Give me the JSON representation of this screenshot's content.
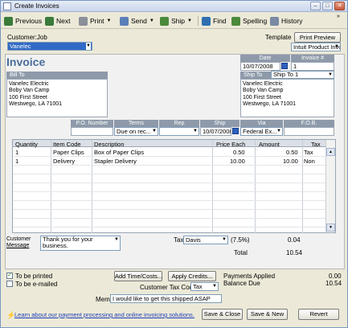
{
  "window": {
    "title": "Create Invoices"
  },
  "toolbar": {
    "previous": "Previous",
    "next": "Next",
    "print": "Print",
    "send": "Send",
    "ship": "Ship",
    "find": "Find",
    "spelling": "Spelling",
    "history": "History"
  },
  "header": {
    "customer_job_label": "Customer:Job",
    "customer_job_value": "Vanelec",
    "template_label": "Template",
    "print_preview": "Print Preview",
    "template_value": "Intuit Product Invoice"
  },
  "invoice": {
    "heading": "Invoice",
    "date_label": "Date",
    "date_value": "10/07/2008",
    "number_label": "Invoice #",
    "number_value": "1",
    "bill_to_label": "Bill To",
    "bill_to_lines": [
      "Vanelec Electric",
      "Boby Van Camp",
      "100 First Street",
      "Westwego, LA 71001"
    ],
    "ship_to_label": "Ship To",
    "ship_to_value": "Ship To 1",
    "ship_to_lines": [
      "Vanelec Electric",
      "Boby Van Camp",
      "100 First Street",
      "Westwego, LA 71001"
    ]
  },
  "details": {
    "po_label": "P.O. Number",
    "po_value": "",
    "terms_label": "Terms",
    "terms_value": "Due on rec...",
    "rep_label": "Rep",
    "rep_value": "",
    "ship_label": "Ship",
    "ship_value": "10/07/2008",
    "via_label": "Via",
    "via_value": "Federal Ex...",
    "fob_label": "F.O.B.",
    "fob_value": ""
  },
  "table": {
    "columns": [
      "Quantity",
      "Item Code",
      "Description",
      "Price Each",
      "Amount",
      "Tax"
    ],
    "rows": [
      [
        "1",
        "Paper Clips",
        "Box of Paper Clips",
        "0.50",
        "0.50",
        "Tax"
      ],
      [
        "1",
        "Delivery",
        "Stapler Delivery",
        "10.00",
        "10.00",
        "Non"
      ]
    ]
  },
  "footer": {
    "customer_message_label_1": "Customer",
    "customer_message_label_2": "Message",
    "customer_message_value": "Thank you for your business.",
    "tax_label": "Tax",
    "tax_value": "Davis",
    "tax_rate": "(7.5%)",
    "tax_amount": "0.04",
    "total_label": "Total",
    "total_value": "10.54",
    "to_be_printed": "To be printed",
    "to_be_emailed": "To be e-mailed",
    "add_time_costs": "Add Time/Costs...",
    "apply_credits": "Apply Credits...",
    "payments_applied_label": "Payments Applied",
    "payments_applied_value": "0.00",
    "balance_due_label": "Balance Due",
    "balance_due_value": "10.54",
    "customer_tax_code_label": "Customer Tax Code",
    "customer_tax_code_value": "Tax",
    "memo_label": "Memo",
    "memo_value": "I would like to get this shipped ASAP",
    "learn_link": "Learn about our payment processing and online invoicing solutions.",
    "save_close": "Save & Close",
    "save_new": "Save & New",
    "revert": "Revert"
  },
  "colors": {
    "accent": "#316ac5",
    "heading": "#4a6d99",
    "header_bar": "#8e9aaa"
  }
}
